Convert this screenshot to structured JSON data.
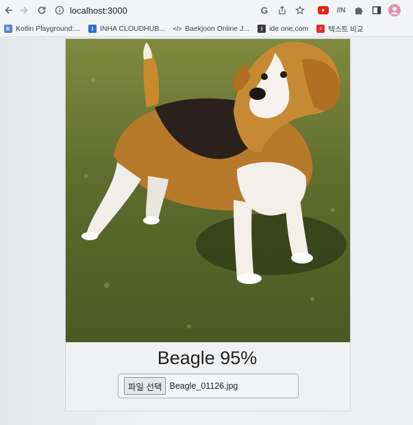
{
  "browser": {
    "url": "localhost:3000",
    "profile_color": "#e88fa8"
  },
  "bookmarks": [
    {
      "label": "Kotlin Playground:...",
      "icon": "kotlin-icon",
      "color": "#5b7fd6"
    },
    {
      "label": "INHA CLOUDHUB...",
      "icon": "cloudhub-icon",
      "color": "#2f6fd0"
    },
    {
      "label": "Baekjoon Online J...",
      "icon": "code-icon",
      "color": "#666666"
    },
    {
      "label": "ide one.com",
      "icon": "ideone-icon",
      "color": "#3a3a3a"
    },
    {
      "label": "텍스트 비교",
      "icon": "lightning-icon",
      "color": "#e0302a"
    }
  ],
  "main": {
    "image_alt": "Beagle",
    "prediction": "Beagle 95%",
    "file_button_label": "파일 선택",
    "file_name": "Beagle_01126.jpg"
  }
}
